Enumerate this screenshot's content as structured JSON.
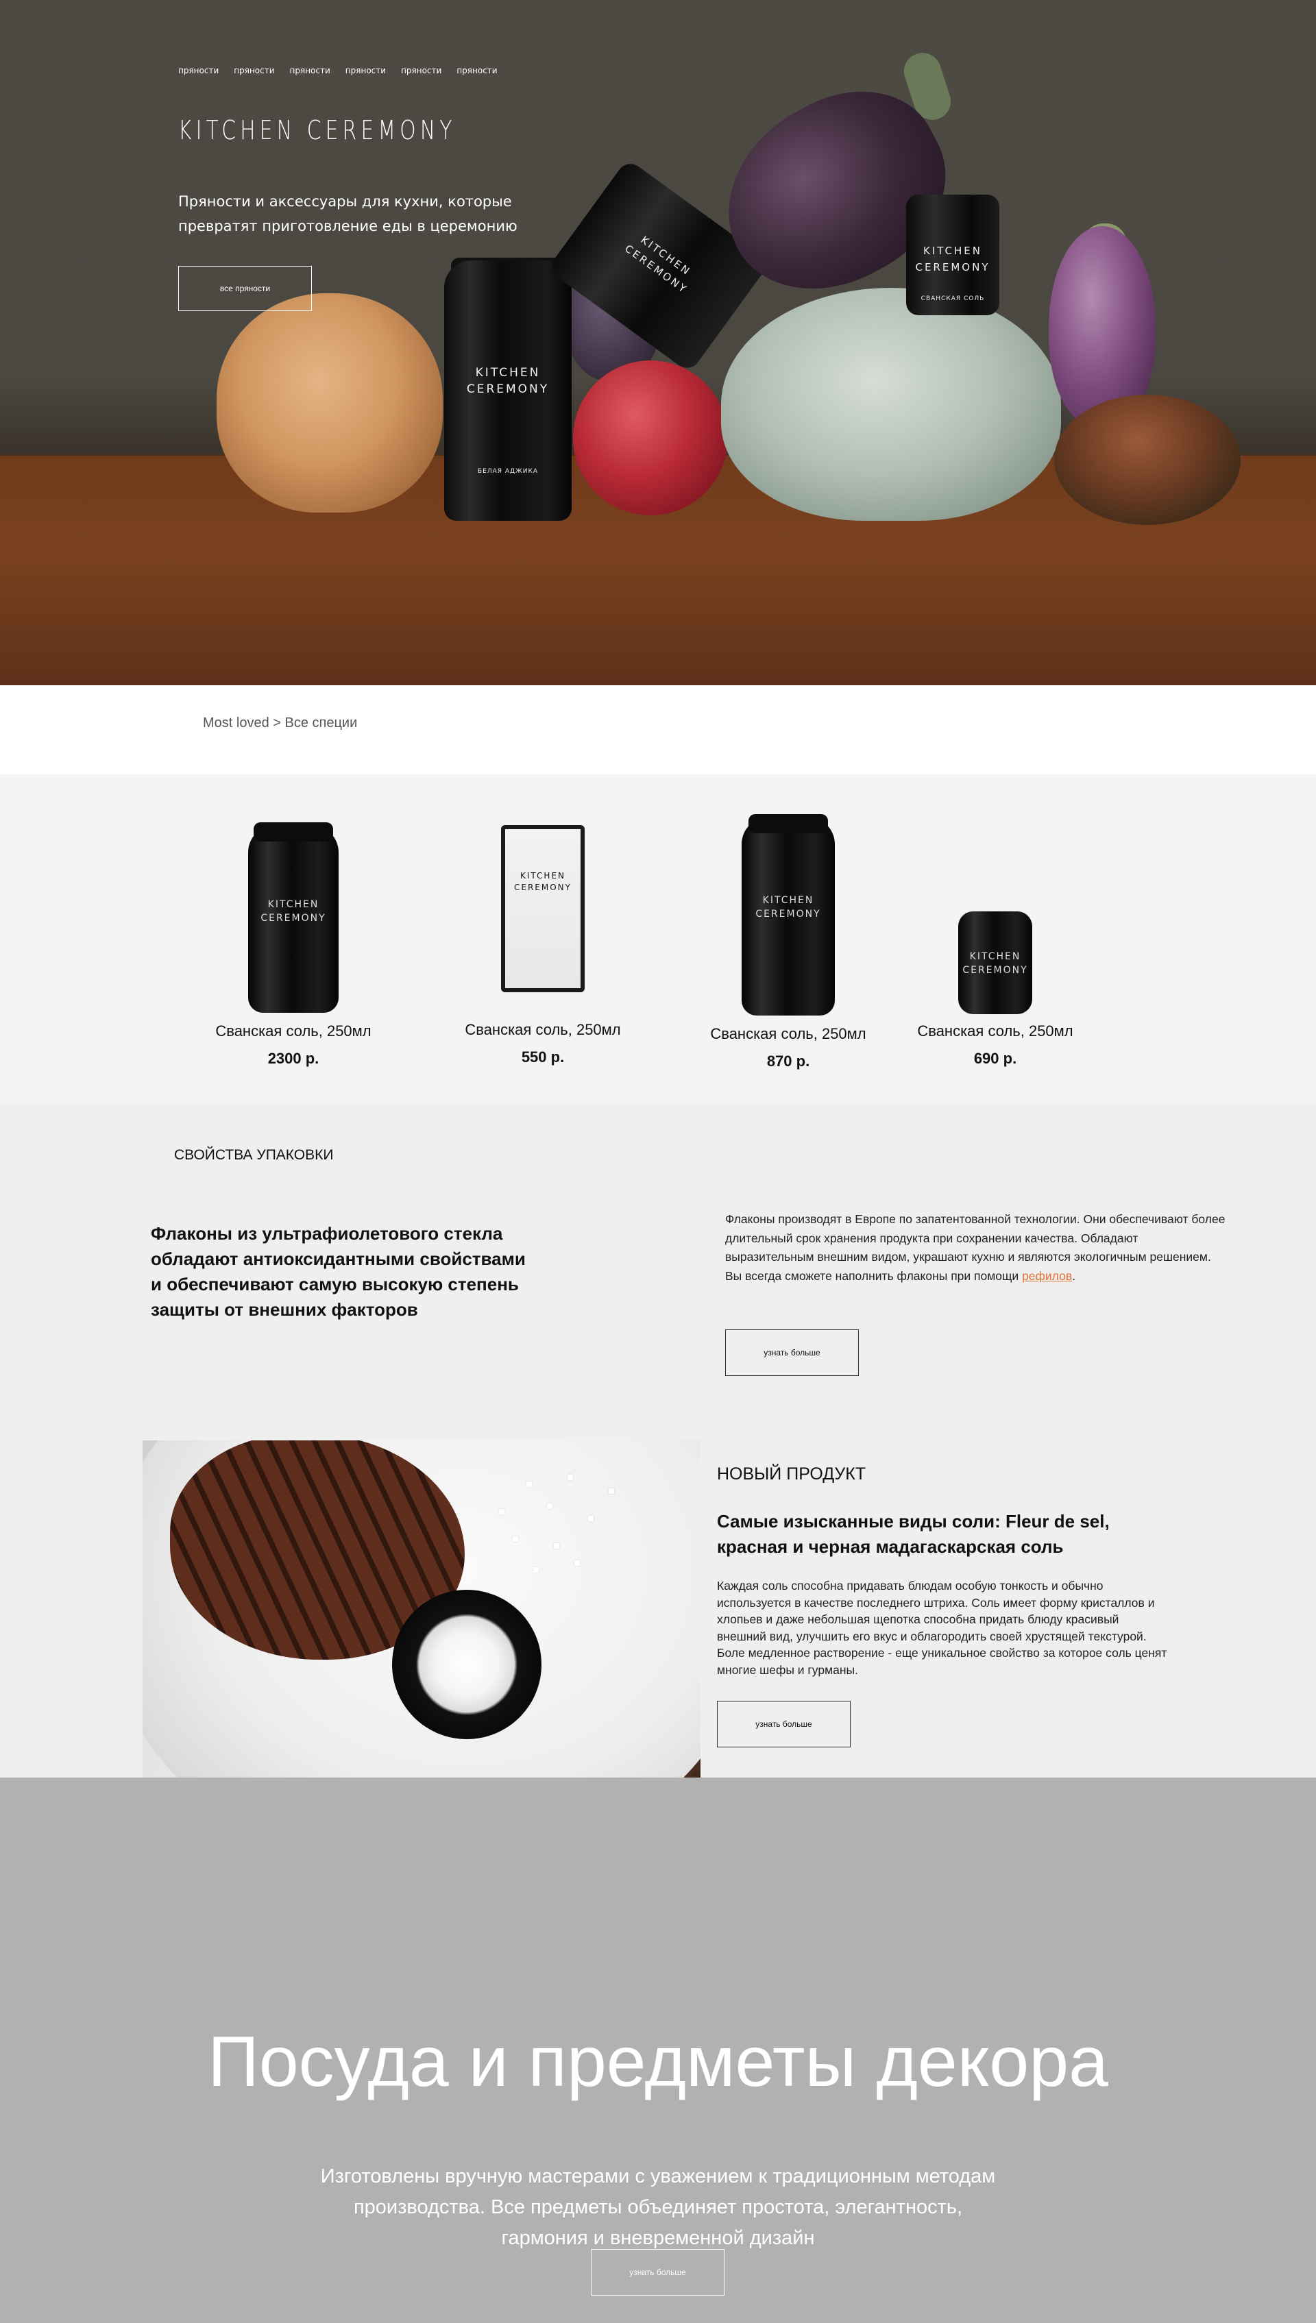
{
  "hero": {
    "nav": [
      "пряности",
      "пряности",
      "пряности",
      "пряности",
      "пряности",
      "пряности"
    ],
    "logo": "KITCHEN CEREMONY",
    "subtitle": "Пряности и аксессуары для кухни, которые превратят приготовление еды в церемонию",
    "button_label": "все пряности",
    "jar_labels": {
      "big_jar": "KITCHEN\nCEREMONY",
      "big_jar_sub": "БЕЛАЯ АДЖИКА",
      "tilted_jar": "KITCHEN\nCEREMONY",
      "small_jar": "KITCHEN\nCEREMONY",
      "small_jar_sub": "СВАНСКАЯ СОЛЬ"
    }
  },
  "breadcrumb": "Most loved > Все специи",
  "products": [
    {
      "name": "Сванская соль, 250мл",
      "price": "2300 р.",
      "brand": "KITCHEN\nCEREMONY"
    },
    {
      "name": "Сванская соль, 250мл",
      "price": "550 р.",
      "brand": "KITCHEN\nCEREMONY"
    },
    {
      "name": "Сванская соль, 250мл",
      "price": "870 р.",
      "brand": "KITCHEN\nCEREMONY"
    },
    {
      "name": "Сванская соль, 250мл",
      "price": "690 р.",
      "brand": "KITCHEN\nCEREMONY"
    }
  ],
  "packaging": {
    "title": "СВОЙСТВА УПАКОВКИ",
    "heading": "Флаконы из ультрафиолетового стекла обладают антиоксидантными свойствами и обеспечивают самую высокую степень защиты от внешних факторов",
    "text": "Флаконы производят в Европе по запатентованной технологии. Они обеспечивают более длительный срок хранения продукта при сохранении качества. Обладают выразительным внешним видом, украшают кухню и являются экологичным решением. Вы всегда сможете наполнить флаконы при помощи ",
    "link": "рефилов",
    "text_end": ".",
    "button_label": "узнать больше"
  },
  "new_product": {
    "kicker": "НОВЫЙ ПРОДУКТ",
    "heading": "Самые изысканные виды соли: Fleur de sel, красная и черная мадагаскарская соль",
    "text": "Каждая соль способна придавать блюдам особую тонкость и обычно используется в качестве последнего штриха. Соль имеет форму кристаллов и хлопьев и даже небольшая щепотка способна придать блюду красивый внешний вид, улучшить его вкус и облагородить своей хрустящей текстурой. Боле медленное растворение - еще уникальное свойство за которое соль ценят многие шефы и гурманы.",
    "button_label": "узнать больше"
  },
  "decor": {
    "title": "Посуда и предметы декора",
    "text": "Изготовлены вручную мастерами с уважением к традиционным методам производства. Все предметы объединяет простота, элегантность, гармония и вневременной дизайн",
    "button_label": "узнать больше"
  },
  "colors": {
    "accent_link": "#e0703a",
    "decor_bg": "#b1b1b1",
    "section_bg": "#efefef"
  }
}
